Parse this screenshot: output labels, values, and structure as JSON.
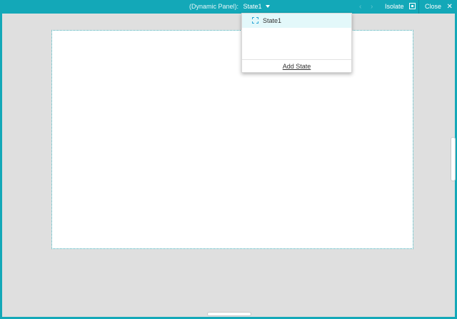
{
  "toolbar": {
    "panel_label": "(Dynamic Panel):",
    "current_state": "State1",
    "prev_arrow": "‹",
    "next_arrow": "›",
    "isolate_label": "Isolate",
    "close_label": "Close",
    "close_glyph": "✕"
  },
  "dropdown": {
    "states": [
      {
        "label": "State1",
        "selected": true
      }
    ],
    "add_state_label": "Add State"
  },
  "colors": {
    "accent": "#13a8b8",
    "canvas_bg": "#dfdfdf",
    "selected_bg": "#e3f8fa"
  },
  "icons": {
    "state_dropdown": "chevron-down-icon",
    "prev": "chevron-left-icon",
    "next": "chevron-right-icon",
    "isolate": "isolate-icon",
    "close": "close-icon",
    "state_item": "state-icon"
  }
}
